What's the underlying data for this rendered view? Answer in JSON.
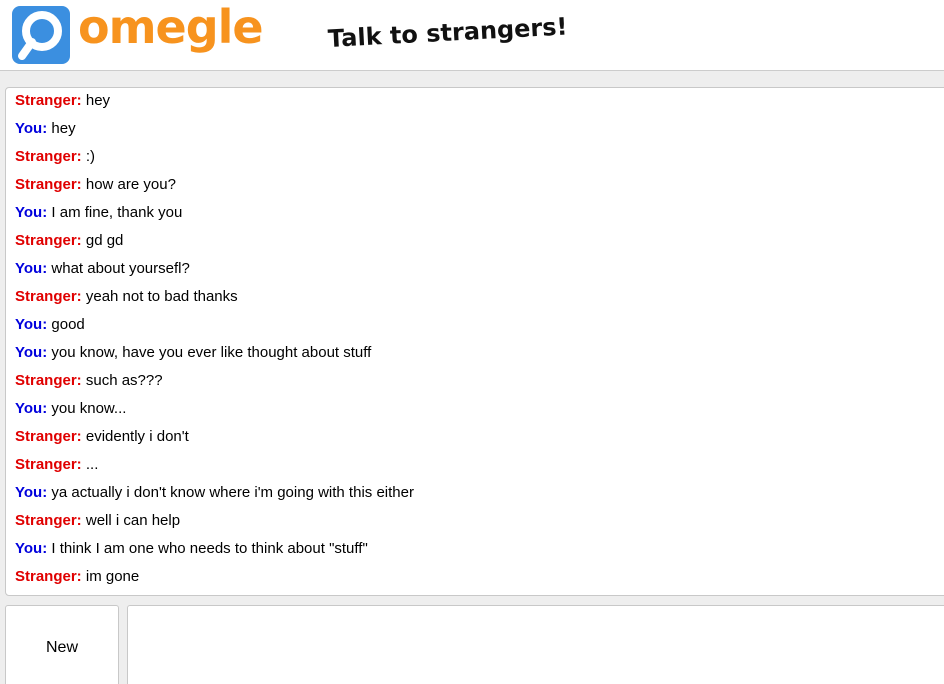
{
  "header": {
    "logo_text": "omegle",
    "tagline": "Talk to strangers!"
  },
  "chat": {
    "messages": [
      {
        "sender": "Stranger:",
        "text": "hey",
        "role": "stranger"
      },
      {
        "sender": "You:",
        "text": "hey",
        "role": "you"
      },
      {
        "sender": "Stranger:",
        "text": ":)",
        "role": "stranger"
      },
      {
        "sender": "Stranger:",
        "text": "how are you?",
        "role": "stranger"
      },
      {
        "sender": "You:",
        "text": "I am fine, thank you",
        "role": "you"
      },
      {
        "sender": "Stranger:",
        "text": "gd gd",
        "role": "stranger"
      },
      {
        "sender": "You:",
        "text": "what about yoursefl?",
        "role": "you"
      },
      {
        "sender": "Stranger:",
        "text": "yeah not to bad thanks",
        "role": "stranger"
      },
      {
        "sender": "You:",
        "text": "good",
        "role": "you"
      },
      {
        "sender": "You:",
        "text": "you know, have you ever like thought about stuff",
        "role": "you"
      },
      {
        "sender": "Stranger:",
        "text": "such as???",
        "role": "stranger"
      },
      {
        "sender": "You:",
        "text": "you know...",
        "role": "you"
      },
      {
        "sender": "Stranger:",
        "text": "evidently i don't",
        "role": "stranger"
      },
      {
        "sender": "Stranger:",
        "text": "...",
        "role": "stranger"
      },
      {
        "sender": "You:",
        "text": "ya actually i don't know where i'm going with this either",
        "role": "you"
      },
      {
        "sender": "Stranger:",
        "text": "well i can help",
        "role": "stranger"
      },
      {
        "sender": "You:",
        "text": "I think I am one who needs to think about \"stuff\"",
        "role": "you"
      },
      {
        "sender": "Stranger:",
        "text": "im gone",
        "role": "stranger"
      }
    ]
  },
  "controls": {
    "new_label": "New",
    "message_value": ""
  },
  "colors": {
    "brand_orange": "#f7931e",
    "brand_blue": "#3b8fe0",
    "stranger_red": "#e00000",
    "you_blue": "#0000dd"
  },
  "icons": {
    "logo": "omegle-logo-icon"
  }
}
